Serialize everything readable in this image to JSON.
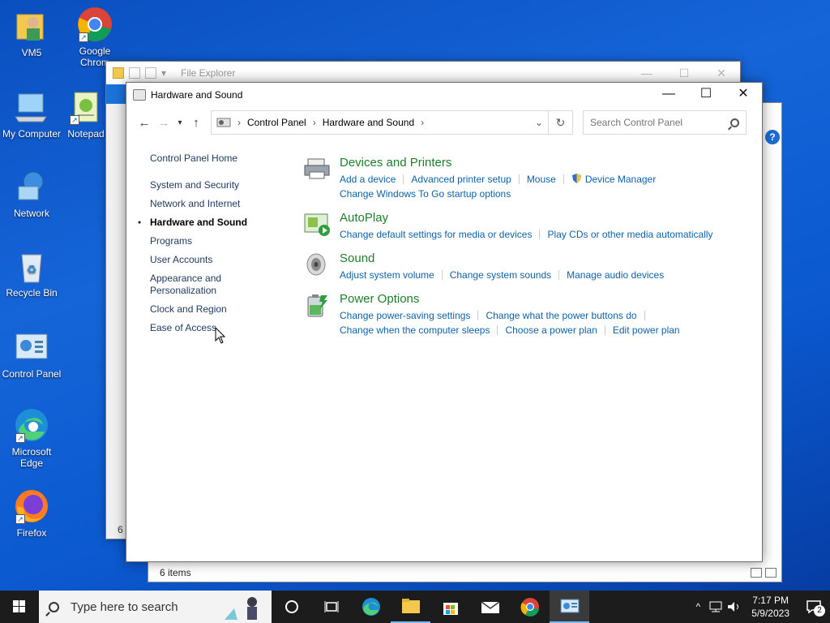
{
  "desktop": {
    "icons": [
      {
        "label": "VM5"
      },
      {
        "label": "Google Chrom"
      },
      {
        "label": "My Computer"
      },
      {
        "label": "Notepad"
      },
      {
        "label": "Network"
      },
      {
        "label": "Recycle Bin"
      },
      {
        "label": "Control Panel"
      },
      {
        "label": "Microsoft Edge"
      },
      {
        "label": "Firefox"
      }
    ]
  },
  "file_explorer": {
    "title": "File Explorer",
    "status": "6 i",
    "status2": "6 items"
  },
  "control_panel": {
    "title": "Hardware and Sound",
    "breadcrumb": [
      "Control Panel",
      "Hardware and Sound"
    ],
    "search_placeholder": "Search Control Panel",
    "sidebar": {
      "home": "Control Panel Home",
      "items": [
        "System and Security",
        "Network and Internet",
        "Hardware and Sound",
        "Programs",
        "User Accounts",
        "Appearance and Personalization",
        "Clock and Region",
        "Ease of Access"
      ]
    },
    "categories": [
      {
        "title": "Devices and Printers",
        "links": [
          "Add a device",
          "Advanced printer setup",
          "Mouse",
          "Device Manager",
          "Change Windows To Go startup options"
        ]
      },
      {
        "title": "AutoPlay",
        "links": [
          "Change default settings for media or devices",
          "Play CDs or other media automatically"
        ]
      },
      {
        "title": "Sound",
        "links": [
          "Adjust system volume",
          "Change system sounds",
          "Manage audio devices"
        ]
      },
      {
        "title": "Power Options",
        "links": [
          "Change power-saving settings",
          "Change what the power buttons do",
          "Change when the computer sleeps",
          "Choose a power plan",
          "Edit power plan"
        ]
      }
    ]
  },
  "taskbar": {
    "search_placeholder": "Type here to search",
    "time": "7:17 PM",
    "date": "5/9/2023",
    "notification_count": "2"
  },
  "colors": {
    "category_title": "#1e7e2a",
    "link": "#0e62a8",
    "desktop": "#0b58cf"
  }
}
